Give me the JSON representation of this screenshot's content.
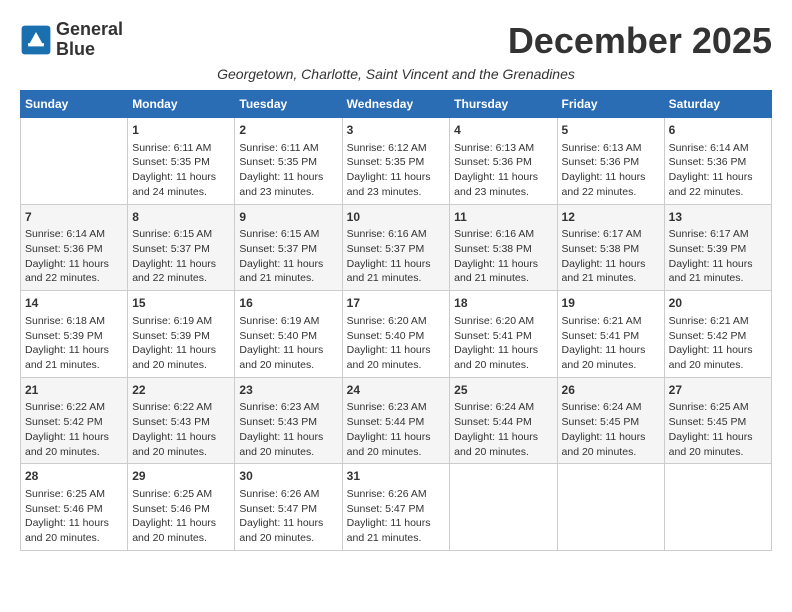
{
  "logo": {
    "line1": "General",
    "line2": "Blue"
  },
  "title": "December 2025",
  "subtitle": "Georgetown, Charlotte, Saint Vincent and the Grenadines",
  "days_header": [
    "Sunday",
    "Monday",
    "Tuesday",
    "Wednesday",
    "Thursday",
    "Friday",
    "Saturday"
  ],
  "weeks": [
    [
      {
        "day": "",
        "info": ""
      },
      {
        "day": "1",
        "info": "Sunrise: 6:11 AM\nSunset: 5:35 PM\nDaylight: 11 hours\nand 24 minutes."
      },
      {
        "day": "2",
        "info": "Sunrise: 6:11 AM\nSunset: 5:35 PM\nDaylight: 11 hours\nand 23 minutes."
      },
      {
        "day": "3",
        "info": "Sunrise: 6:12 AM\nSunset: 5:35 PM\nDaylight: 11 hours\nand 23 minutes."
      },
      {
        "day": "4",
        "info": "Sunrise: 6:13 AM\nSunset: 5:36 PM\nDaylight: 11 hours\nand 23 minutes."
      },
      {
        "day": "5",
        "info": "Sunrise: 6:13 AM\nSunset: 5:36 PM\nDaylight: 11 hours\nand 22 minutes."
      },
      {
        "day": "6",
        "info": "Sunrise: 6:14 AM\nSunset: 5:36 PM\nDaylight: 11 hours\nand 22 minutes."
      }
    ],
    [
      {
        "day": "7",
        "info": "Sunrise: 6:14 AM\nSunset: 5:36 PM\nDaylight: 11 hours\nand 22 minutes."
      },
      {
        "day": "8",
        "info": "Sunrise: 6:15 AM\nSunset: 5:37 PM\nDaylight: 11 hours\nand 22 minutes."
      },
      {
        "day": "9",
        "info": "Sunrise: 6:15 AM\nSunset: 5:37 PM\nDaylight: 11 hours\nand 21 minutes."
      },
      {
        "day": "10",
        "info": "Sunrise: 6:16 AM\nSunset: 5:37 PM\nDaylight: 11 hours\nand 21 minutes."
      },
      {
        "day": "11",
        "info": "Sunrise: 6:16 AM\nSunset: 5:38 PM\nDaylight: 11 hours\nand 21 minutes."
      },
      {
        "day": "12",
        "info": "Sunrise: 6:17 AM\nSunset: 5:38 PM\nDaylight: 11 hours\nand 21 minutes."
      },
      {
        "day": "13",
        "info": "Sunrise: 6:17 AM\nSunset: 5:39 PM\nDaylight: 11 hours\nand 21 minutes."
      }
    ],
    [
      {
        "day": "14",
        "info": "Sunrise: 6:18 AM\nSunset: 5:39 PM\nDaylight: 11 hours\nand 21 minutes."
      },
      {
        "day": "15",
        "info": "Sunrise: 6:19 AM\nSunset: 5:39 PM\nDaylight: 11 hours\nand 20 minutes."
      },
      {
        "day": "16",
        "info": "Sunrise: 6:19 AM\nSunset: 5:40 PM\nDaylight: 11 hours\nand 20 minutes."
      },
      {
        "day": "17",
        "info": "Sunrise: 6:20 AM\nSunset: 5:40 PM\nDaylight: 11 hours\nand 20 minutes."
      },
      {
        "day": "18",
        "info": "Sunrise: 6:20 AM\nSunset: 5:41 PM\nDaylight: 11 hours\nand 20 minutes."
      },
      {
        "day": "19",
        "info": "Sunrise: 6:21 AM\nSunset: 5:41 PM\nDaylight: 11 hours\nand 20 minutes."
      },
      {
        "day": "20",
        "info": "Sunrise: 6:21 AM\nSunset: 5:42 PM\nDaylight: 11 hours\nand 20 minutes."
      }
    ],
    [
      {
        "day": "21",
        "info": "Sunrise: 6:22 AM\nSunset: 5:42 PM\nDaylight: 11 hours\nand 20 minutes."
      },
      {
        "day": "22",
        "info": "Sunrise: 6:22 AM\nSunset: 5:43 PM\nDaylight: 11 hours\nand 20 minutes."
      },
      {
        "day": "23",
        "info": "Sunrise: 6:23 AM\nSunset: 5:43 PM\nDaylight: 11 hours\nand 20 minutes."
      },
      {
        "day": "24",
        "info": "Sunrise: 6:23 AM\nSunset: 5:44 PM\nDaylight: 11 hours\nand 20 minutes."
      },
      {
        "day": "25",
        "info": "Sunrise: 6:24 AM\nSunset: 5:44 PM\nDaylight: 11 hours\nand 20 minutes."
      },
      {
        "day": "26",
        "info": "Sunrise: 6:24 AM\nSunset: 5:45 PM\nDaylight: 11 hours\nand 20 minutes."
      },
      {
        "day": "27",
        "info": "Sunrise: 6:25 AM\nSunset: 5:45 PM\nDaylight: 11 hours\nand 20 minutes."
      }
    ],
    [
      {
        "day": "28",
        "info": "Sunrise: 6:25 AM\nSunset: 5:46 PM\nDaylight: 11 hours\nand 20 minutes."
      },
      {
        "day": "29",
        "info": "Sunrise: 6:25 AM\nSunset: 5:46 PM\nDaylight: 11 hours\nand 20 minutes."
      },
      {
        "day": "30",
        "info": "Sunrise: 6:26 AM\nSunset: 5:47 PM\nDaylight: 11 hours\nand 20 minutes."
      },
      {
        "day": "31",
        "info": "Sunrise: 6:26 AM\nSunset: 5:47 PM\nDaylight: 11 hours\nand 21 minutes."
      },
      {
        "day": "",
        "info": ""
      },
      {
        "day": "",
        "info": ""
      },
      {
        "day": "",
        "info": ""
      }
    ]
  ]
}
